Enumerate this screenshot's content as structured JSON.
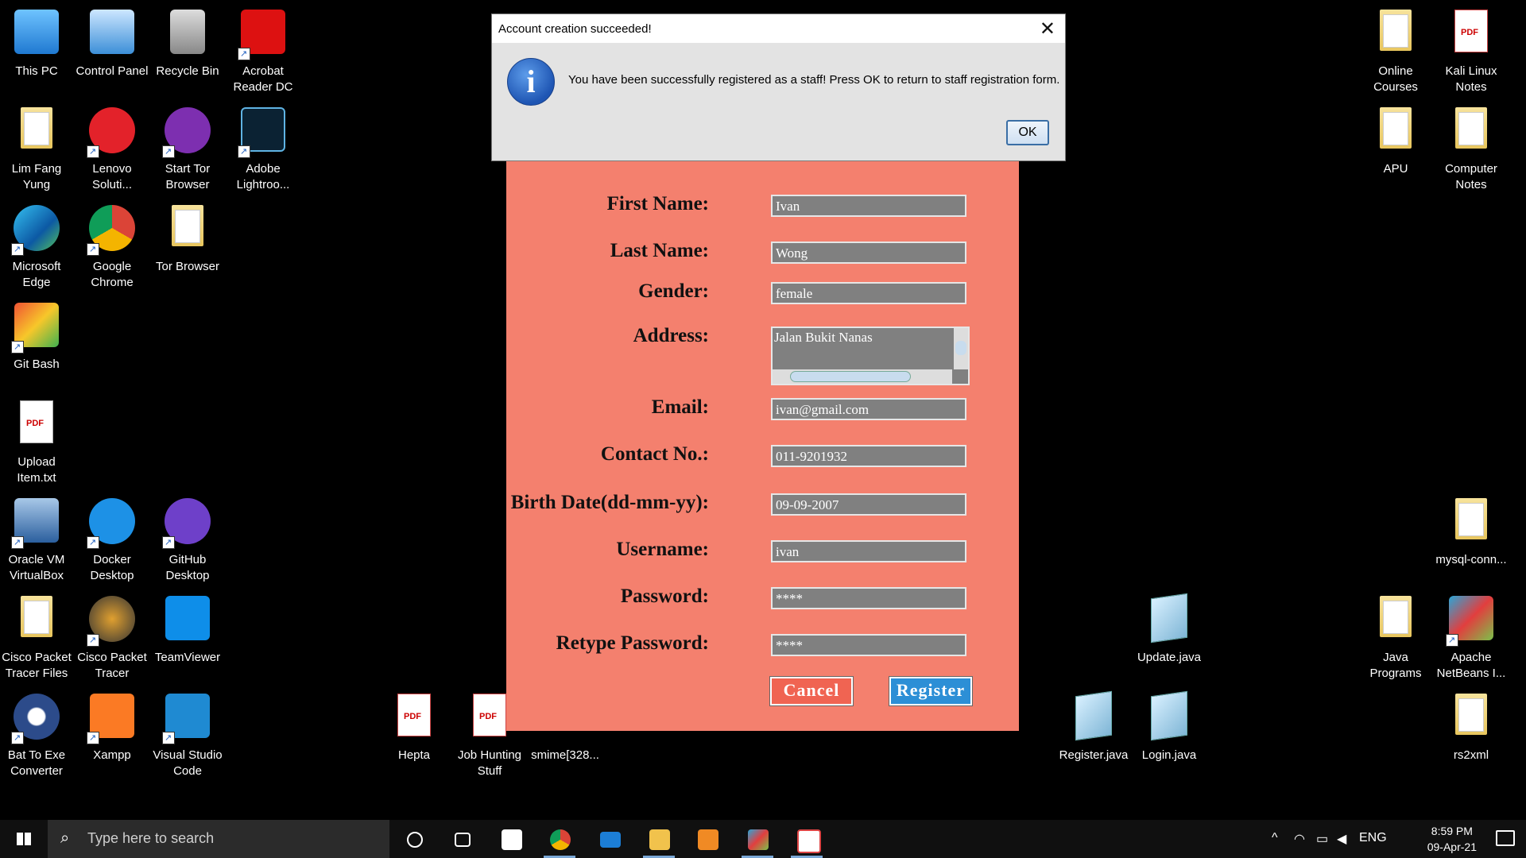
{
  "desktop": {
    "icons": [
      {
        "label": "This PC"
      },
      {
        "label": "Control Panel"
      },
      {
        "label": "Recycle Bin"
      },
      {
        "label": "Acrobat Reader DC"
      },
      {
        "label": "Lim Fang Yung"
      },
      {
        "label": "Lenovo Soluti..."
      },
      {
        "label": "Start Tor Browser"
      },
      {
        "label": "Adobe Lightroo..."
      },
      {
        "label": "Microsoft Edge"
      },
      {
        "label": "Google Chrome"
      },
      {
        "label": "Tor Browser"
      },
      {
        "label": "Git Bash"
      },
      {
        "label": "Upload Item.txt"
      },
      {
        "label": "Oracle VM VirtualBox"
      },
      {
        "label": "Docker Desktop"
      },
      {
        "label": "GitHub Desktop"
      },
      {
        "label": "Cisco Packet Tracer Files"
      },
      {
        "label": "Cisco Packet Tracer"
      },
      {
        "label": "TeamViewer"
      },
      {
        "label": "Bat To Exe Converter"
      },
      {
        "label": "Xampp"
      },
      {
        "label": "Visual Studio Code"
      },
      {
        "label": "Hepta"
      },
      {
        "label": "Job Hunting Stuff"
      },
      {
        "label": "smime[328..."
      },
      {
        "label": "Update.java"
      },
      {
        "label": "Register.java"
      },
      {
        "label": "Login.java"
      },
      {
        "label": "Online Courses"
      },
      {
        "label": "Kali Linux Notes"
      },
      {
        "label": "APU"
      },
      {
        "label": "Computer Notes"
      },
      {
        "label": "mysql-conn..."
      },
      {
        "label": "Java Programs"
      },
      {
        "label": "Apache NetBeans I..."
      },
      {
        "label": "rs2xml"
      }
    ]
  },
  "form": {
    "fields": [
      {
        "label": "First Name:",
        "value": "Ivan"
      },
      {
        "label": "Last Name:",
        "value": "Wong"
      },
      {
        "label": "Gender:",
        "value": "female"
      },
      {
        "label": "Address:",
        "value": "Jalan Bukit Nanas"
      },
      {
        "label": "Email:",
        "value": "ivan@gmail.com"
      },
      {
        "label": "Contact No.:",
        "value": "011-9201932"
      },
      {
        "label": "Birth Date(dd-mm-yy):",
        "value": "09-09-2007"
      },
      {
        "label": "Username:",
        "value": "ivan"
      },
      {
        "label": "Password:",
        "value": "****"
      },
      {
        "label": "Retype Password:",
        "value": "****"
      }
    ],
    "cancel_label": "Cancel",
    "register_label": "Register"
  },
  "dialog": {
    "title": "Account creation succeeded!",
    "message": "You have been successfully registered as a staff! Press OK to return to staff registration form.",
    "ok_label": "OK",
    "close_glyph": "✕"
  },
  "taskbar": {
    "search_placeholder": "Type here to search",
    "language": "ENG",
    "time": "8:59 PM",
    "date": "09-Apr-21",
    "colors": {
      "background": "#101010",
      "search_box": "#2b2b2b"
    }
  }
}
